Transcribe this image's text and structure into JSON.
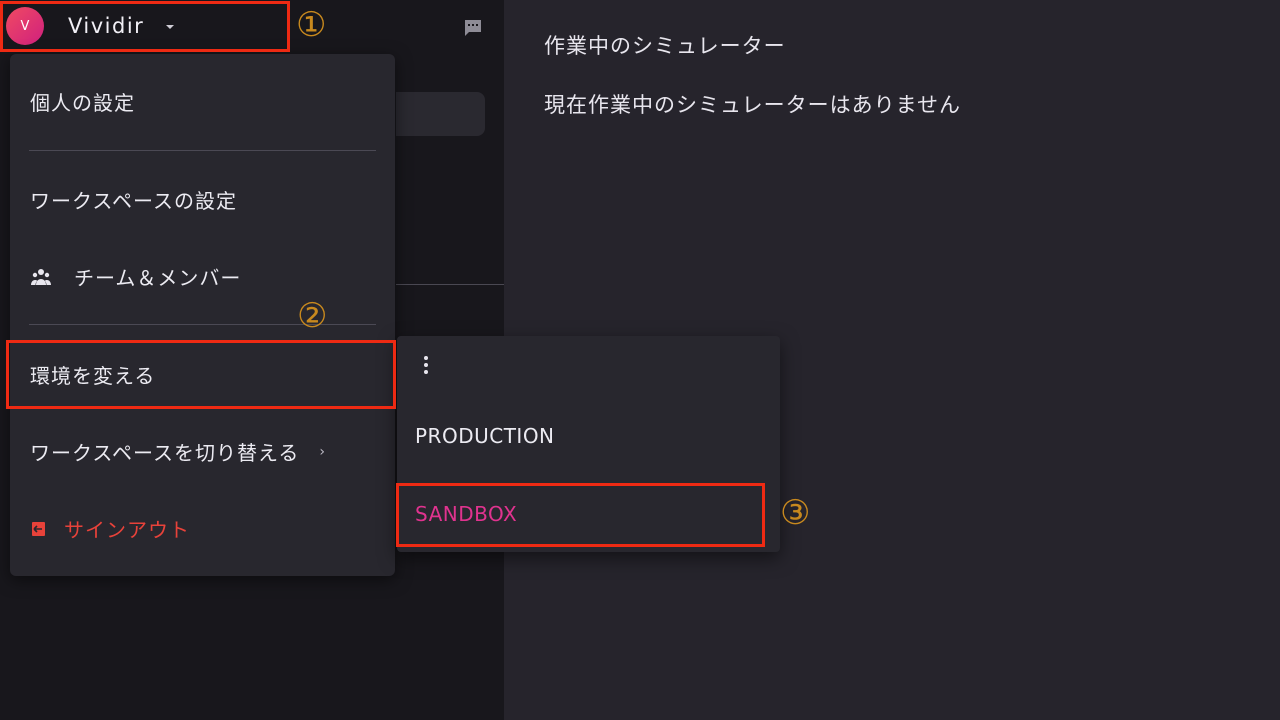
{
  "workspace": {
    "avatar_letter": "V",
    "name": "Vividir"
  },
  "main": {
    "title": "作業中のシミュレーター",
    "empty_message": "現在作業中のシミュレーターはありません"
  },
  "menu": {
    "personal_settings": "個人の設定",
    "workspace_settings": "ワークスペースの設定",
    "team_members": "チーム＆メンバー",
    "change_environment": "環境を変える",
    "switch_workspace": "ワークスペースを切り替える",
    "sign_out": "サインアウト"
  },
  "environment_submenu": {
    "options": [
      "PRODUCTION",
      "SANDBOX"
    ],
    "selected": "SANDBOX"
  },
  "annotations": {
    "step1": "①",
    "step2": "②",
    "step3": "③"
  },
  "colors": {
    "accent": "#e0338f",
    "danger": "#e8423a",
    "highlight_box": "#ee2a13",
    "step_number": "#c8891e"
  },
  "icons": [
    "chevron-down-icon",
    "chat-icon",
    "team-icon",
    "chevron-right-icon",
    "signout-icon",
    "kebab-icon"
  ]
}
